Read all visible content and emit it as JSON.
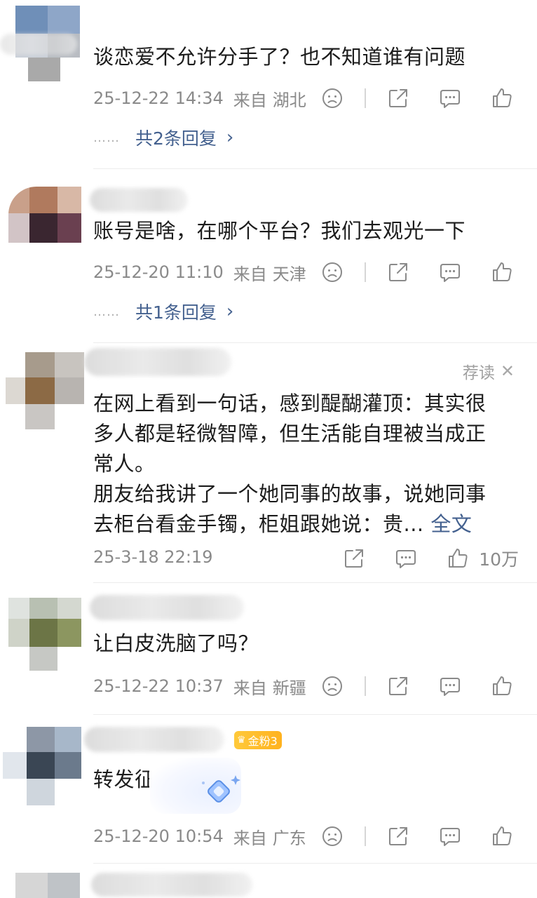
{
  "comments": [
    {
      "text": "谈恋爱不允许分手了？也不知道谁有问题",
      "time": "25-12-22 14:34",
      "loc_label": "来自",
      "location": "湖北",
      "reply_text": "共2条回复"
    },
    {
      "text": "账号是啥，在哪个平台？我们去观光一下",
      "time": "25-12-20 11:10",
      "loc_label": "来自",
      "location": "天津",
      "reply_text": "共1条回复"
    },
    {
      "text": "在网上看到一句话，感到醍醐灌顶：其实很\n多人都是轻微智障，但生活能自理被当成正\n常人。\n朋友给我讲了一个她同事的故事，说她同事\n去柜台看金手镯，柜姐跟她说：贵... ",
      "full_link": "全文",
      "time": "25-3-18 22:19",
      "recommend_label": "荐读",
      "recommend_close": "✕",
      "like_count": "10万"
    },
    {
      "text": "让白皮洗脑了吗？",
      "time": "25-12-22 10:37",
      "loc_label": "来自",
      "location": "新疆"
    },
    {
      "text": "转发征",
      "badge": "金粉3",
      "time": "25-12-20 10:54",
      "loc_label": "来自",
      "location": "广东"
    }
  ],
  "ui": {
    "reply_dots": "……",
    "reply_chevron": "›",
    "icons": [
      "dislike-icon",
      "share-icon",
      "comment-icon",
      "like-icon"
    ]
  }
}
